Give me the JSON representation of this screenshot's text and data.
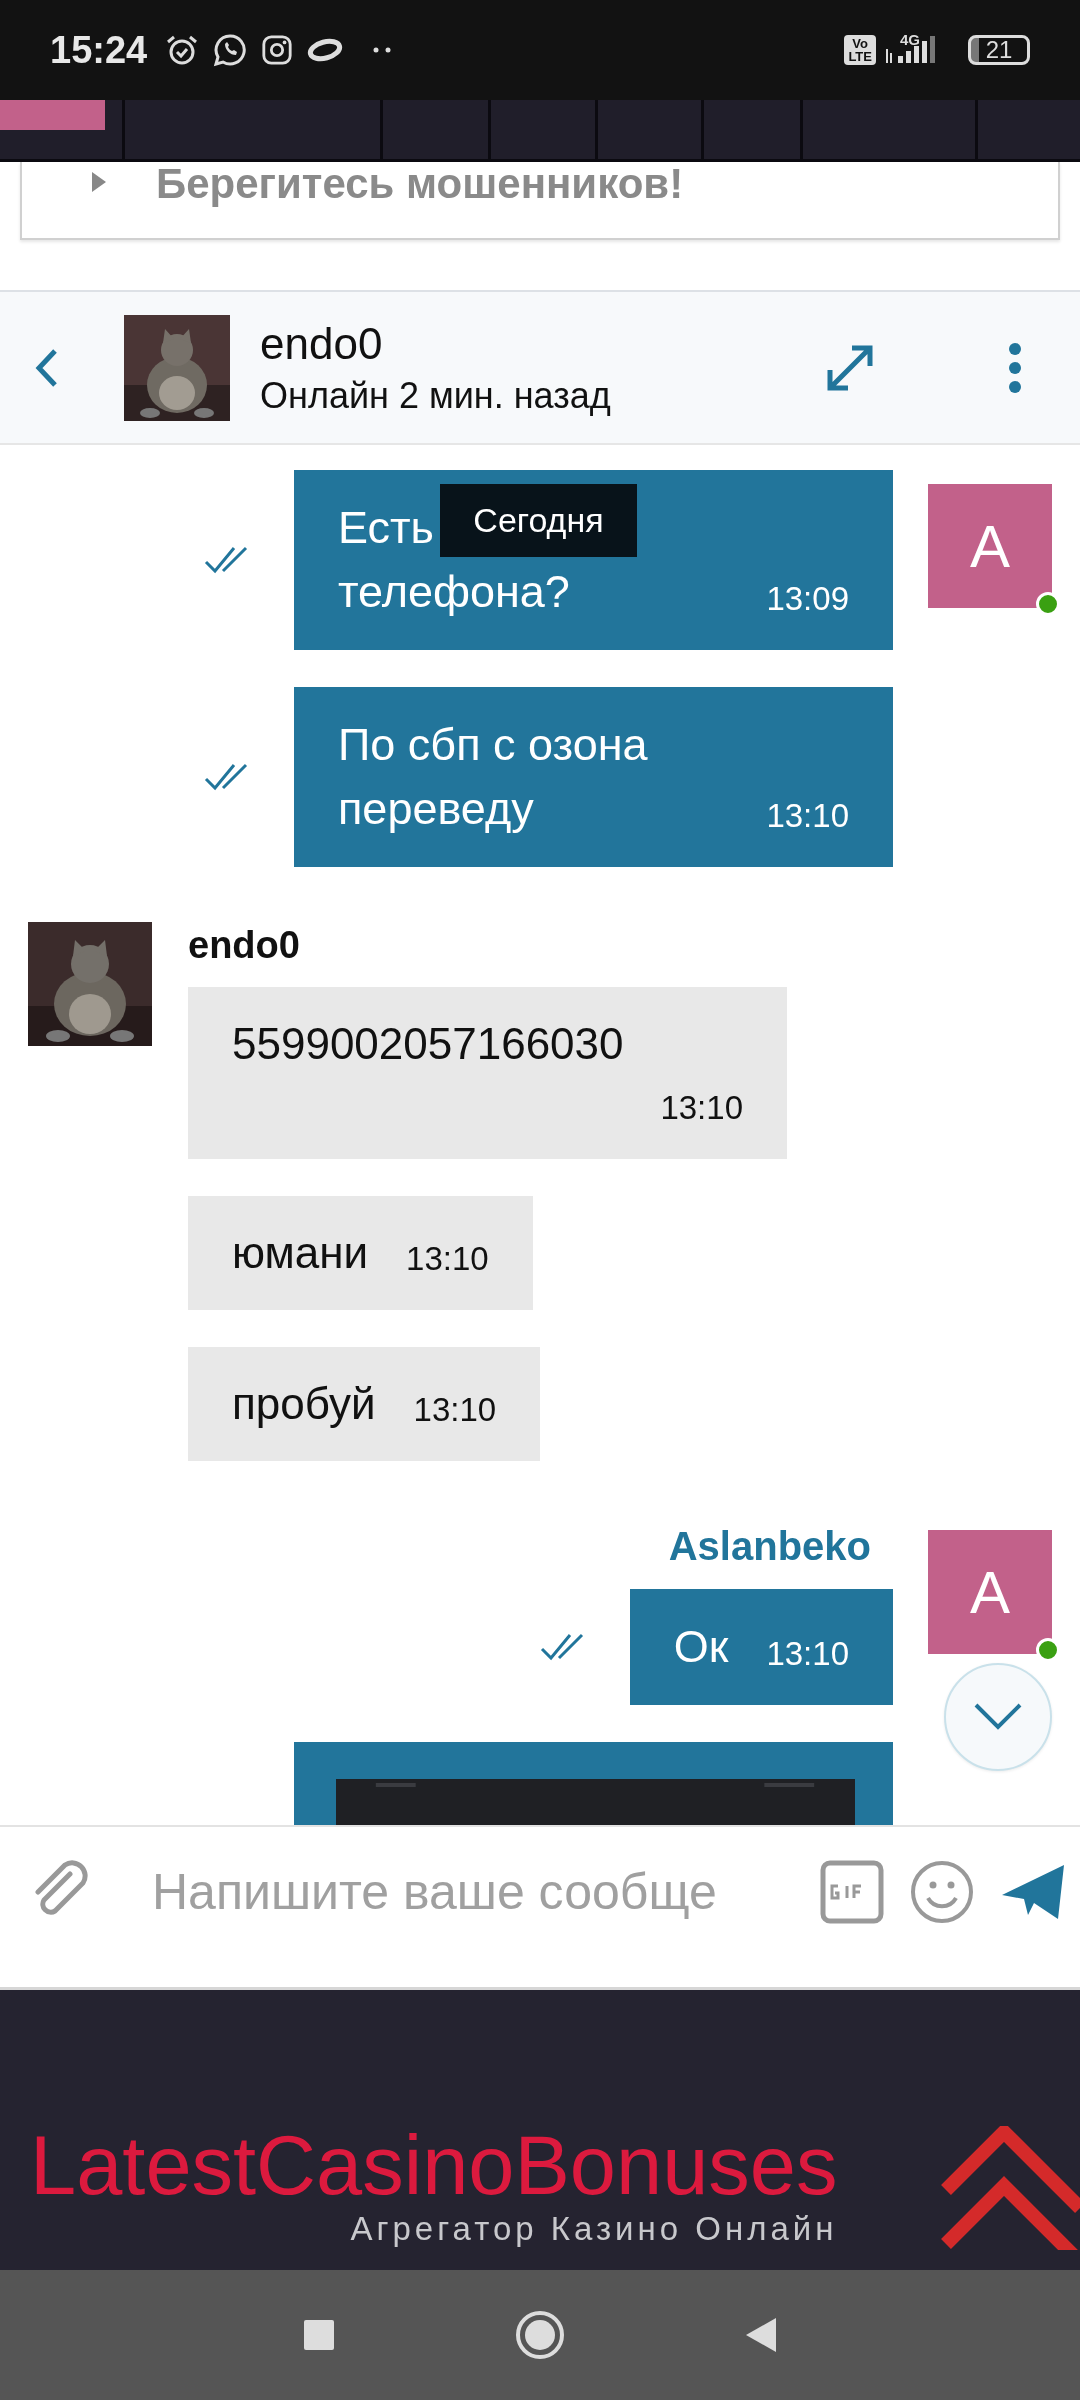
{
  "status_bar": {
    "time": "15:24",
    "volte": [
      "Vo",
      "LTE"
    ],
    "network": "4G",
    "battery": "21"
  },
  "notice": {
    "text": "Берегитесь мошенников!"
  },
  "chat_header": {
    "name": "endo0",
    "status": "Онлайн 2 мин. назад"
  },
  "date_badge": "Сегодня",
  "groups": [
    {
      "kind": "outgoing",
      "avatar": "A",
      "online": true,
      "messages": [
        {
          "kind": "text",
          "lines": [
            "Есть",
            "телефона?"
          ],
          "time": "13:09",
          "read": true
        },
        {
          "kind": "text",
          "lines": [
            "По сбп с озона",
            "переведу"
          ],
          "time": "13:10",
          "read": true
        }
      ]
    },
    {
      "kind": "incoming",
      "author": "endo0",
      "messages": [
        {
          "kind": "text",
          "lines": [
            "5599002057166030"
          ],
          "time": "13:10"
        },
        {
          "kind": "text",
          "lines": [
            "юмани"
          ],
          "time": "13:10"
        },
        {
          "kind": "text",
          "lines": [
            "пробуй"
          ],
          "time": "13:10"
        }
      ]
    },
    {
      "kind": "outgoing",
      "author": "Aslanbeko",
      "avatar": "A",
      "online": true,
      "messages": [
        {
          "kind": "text",
          "lines": [
            "Ок"
          ],
          "time": "13:10",
          "read": true
        },
        {
          "kind": "picture"
        }
      ]
    }
  ],
  "composer": {
    "placeholder": "Напишите ваше сообще"
  },
  "footer": {
    "logo": "LatestCasinoBonuses",
    "tagline": "Агрегатор Казино Онлайн"
  }
}
